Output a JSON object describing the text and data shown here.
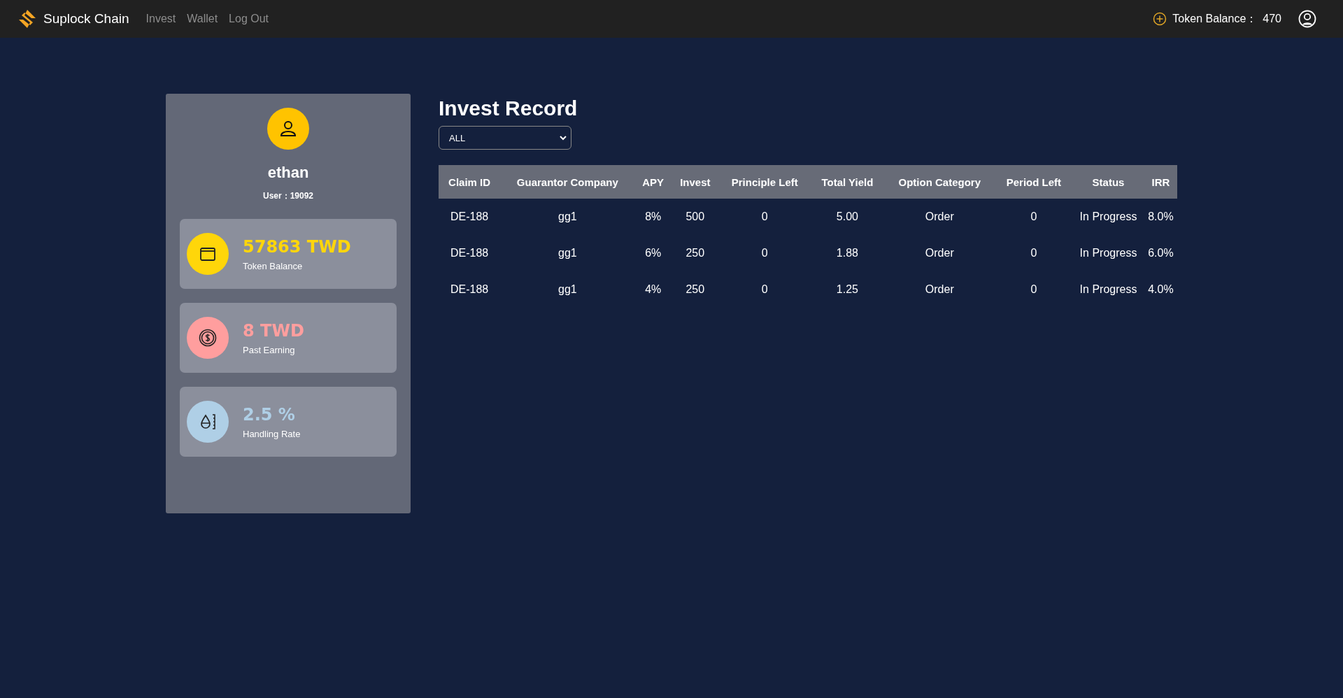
{
  "navbar": {
    "brand": "Suplock Chain",
    "links": [
      "Invest",
      "Wallet",
      "Log Out"
    ],
    "balance_label": "Token Balance：",
    "balance_value": "470"
  },
  "profile": {
    "name": "ethan",
    "user_id": "User：19092",
    "stats": [
      {
        "kind": "wallet",
        "value": "57863 TWD",
        "label": "Token Balance",
        "color": "#ffd60a"
      },
      {
        "kind": "coin",
        "value": "8 TWD",
        "label": "Past Earning",
        "color": "#ff9e9e"
      },
      {
        "kind": "rate",
        "value": "2.5 %",
        "label": "Handling Rate",
        "color": "#afcfe6"
      }
    ]
  },
  "record": {
    "title": "Invest Record",
    "filter": {
      "value": "ALL"
    },
    "table": {
      "columns": [
        "Claim ID",
        "Guarantor Company",
        "APY",
        "Invest",
        "Principle Left",
        "Total Yield",
        "Option Category",
        "Period Left",
        "Status",
        "IRR"
      ],
      "rows": [
        [
          "DE-188",
          "gg1",
          "8%",
          "500",
          "0",
          "5.00",
          "Order",
          "0",
          "In Progress",
          "8.0%"
        ],
        [
          "DE-188",
          "gg1",
          "6%",
          "250",
          "0",
          "1.88",
          "Order",
          "0",
          "In Progress",
          "6.0%"
        ],
        [
          "DE-188",
          "gg1",
          "4%",
          "250",
          "0",
          "1.25",
          "Order",
          "0",
          "In Progress",
          "4.0%"
        ]
      ]
    }
  }
}
